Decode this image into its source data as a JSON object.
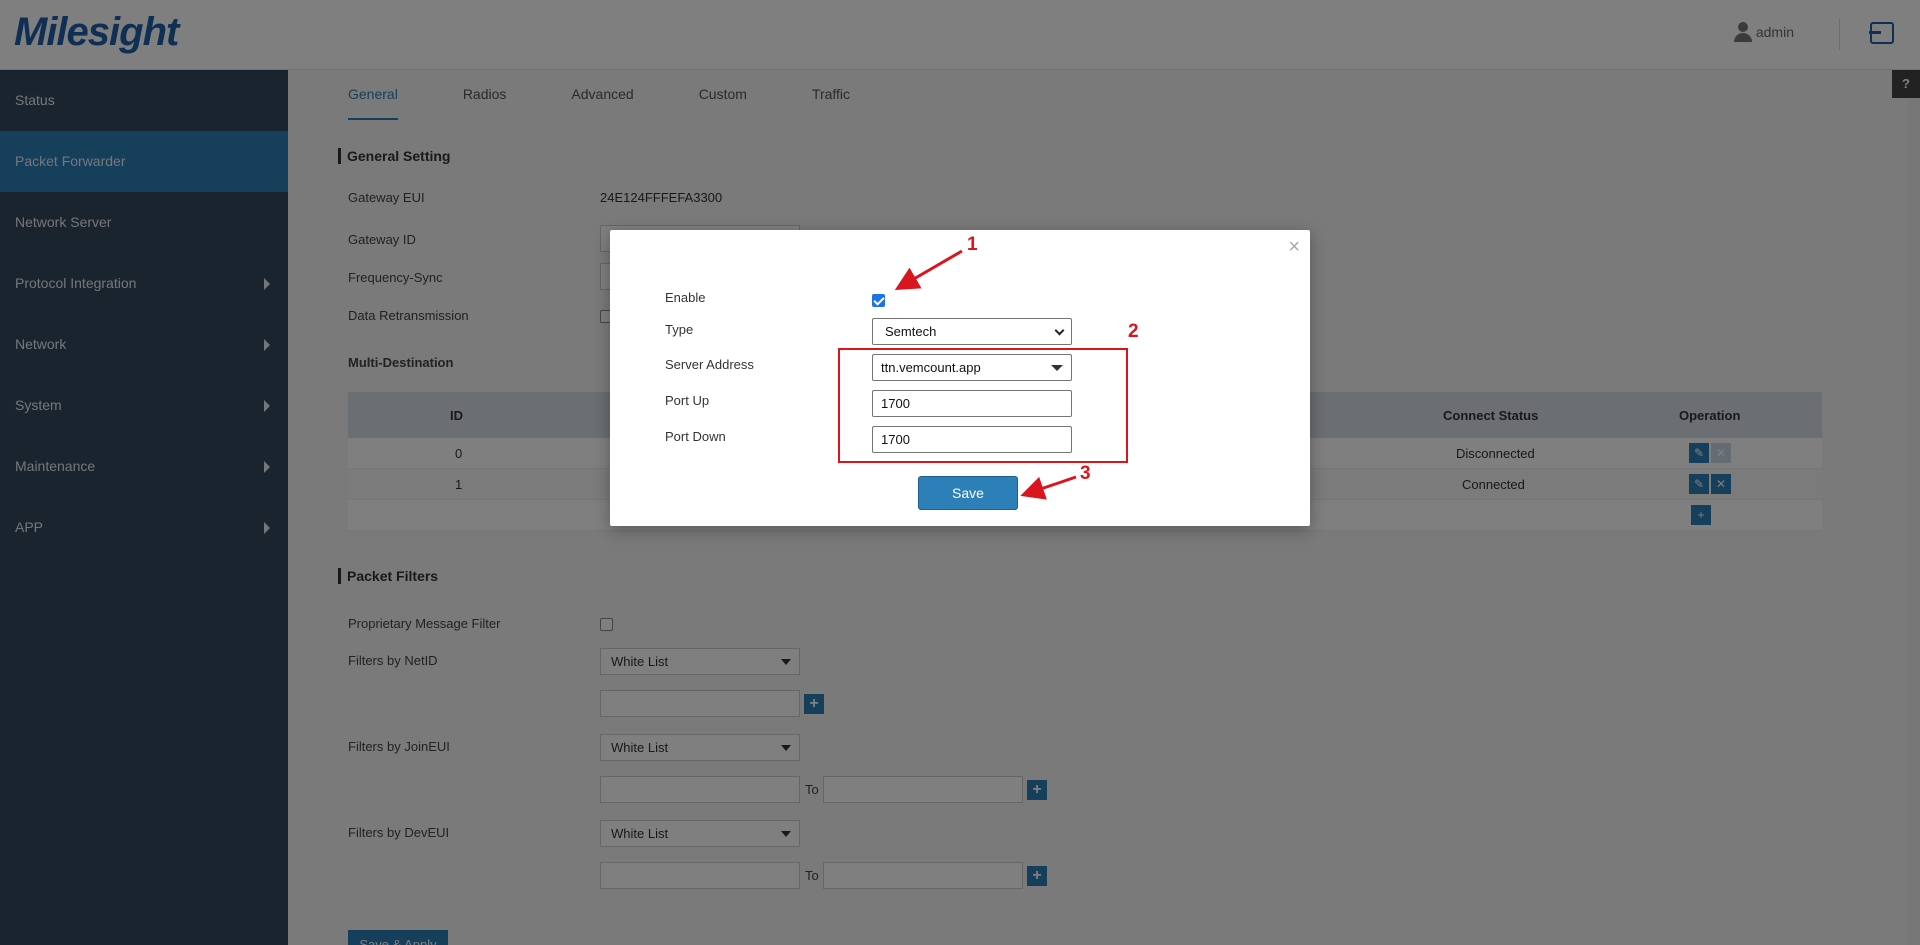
{
  "header": {
    "logo_text": "Milesight",
    "user_label": "admin",
    "icons": {
      "user": "user-icon",
      "logout": "logout-icon"
    }
  },
  "sidebar": {
    "items": [
      {
        "label": "Status",
        "has_submenu": false,
        "active": false
      },
      {
        "label": "Packet Forwarder",
        "has_submenu": false,
        "active": true
      },
      {
        "label": "Network Server",
        "has_submenu": false,
        "active": false
      },
      {
        "label": "Protocol Integration",
        "has_submenu": true,
        "active": false
      },
      {
        "label": "Network",
        "has_submenu": true,
        "active": false
      },
      {
        "label": "System",
        "has_submenu": true,
        "active": false
      },
      {
        "label": "Maintenance",
        "has_submenu": true,
        "active": false
      },
      {
        "label": "APP",
        "has_submenu": true,
        "active": false
      }
    ]
  },
  "tabs": [
    {
      "label": "General",
      "active": true
    },
    {
      "label": "Radios",
      "active": false
    },
    {
      "label": "Advanced",
      "active": false
    },
    {
      "label": "Custom",
      "active": false
    },
    {
      "label": "Traffic",
      "active": false
    }
  ],
  "help_label": "?",
  "general": {
    "title": "General Setting",
    "gateway_eui_label": "Gateway EUI",
    "gateway_eui_value": "24E124FFFEFA3300",
    "gateway_id_label": "Gateway ID",
    "frequency_sync_label": "Frequency-Sync",
    "data_retransmission_label": "Data Retransmission",
    "multi_destination_label": "Multi-Destination"
  },
  "dest_table": {
    "headers": {
      "id": "ID",
      "connect_status": "Connect Status",
      "operation": "Operation"
    },
    "rows": [
      {
        "id": "0",
        "status": "Disconnected"
      },
      {
        "id": "1",
        "status": "Connected"
      }
    ],
    "edit_glyph": "✎",
    "delete_glyph": "✕",
    "add_glyph": "+"
  },
  "filters": {
    "title": "Packet Filters",
    "proprietary_label": "Proprietary Message Filter",
    "netid_label": "Filters by NetID",
    "joineui_label": "Filters by JoinEUI",
    "deveui_label": "Filters by DevEUI",
    "list_option": "White List",
    "to_label": "To",
    "add_glyph": "+"
  },
  "save_apply_label": "Save & Apply",
  "modal": {
    "close_glyph": "×",
    "enable_label": "Enable",
    "enable_checked": true,
    "type_label": "Type",
    "type_value": "Semtech",
    "server_address_label": "Server Address",
    "server_address_value": "ttn.vemcount.app",
    "port_up_label": "Port Up",
    "port_up_value": "1700",
    "port_down_label": "Port Down",
    "port_down_value": "1700",
    "save_label": "Save"
  },
  "annotations": {
    "labels": [
      "1",
      "2",
      "3"
    ],
    "color": "#d9161e"
  },
  "colors": {
    "sidebar_bg": "#34495e",
    "accent": "#2d7fb8",
    "brand": "#1f5ea8"
  }
}
